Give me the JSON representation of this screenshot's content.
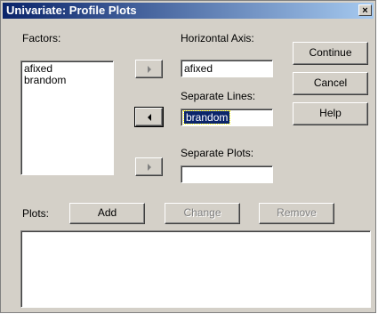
{
  "window": {
    "title": "Univariate: Profile Plots",
    "close_glyph": "×"
  },
  "factors": {
    "label": "Factors:",
    "items": [
      "afixed",
      "brandom"
    ]
  },
  "horizontal_axis": {
    "label": "Horizontal Axis:",
    "value": "afixed"
  },
  "separate_lines": {
    "label": "Separate Lines:",
    "value": "brandom"
  },
  "separate_plots": {
    "label": "Separate Plots:",
    "value": ""
  },
  "arrows": {
    "right": "right-arrow",
    "left": "left-arrow"
  },
  "buttons": {
    "continue": "Continue",
    "cancel": "Cancel",
    "help": "Help"
  },
  "plots": {
    "label": "Plots:",
    "add": "Add",
    "change": "Change",
    "remove": "Remove",
    "items": []
  },
  "colors": {
    "title_start": "#0a246a",
    "title_end": "#a6caf0",
    "face": "#d4d0c8",
    "selection": "#0a246a"
  }
}
